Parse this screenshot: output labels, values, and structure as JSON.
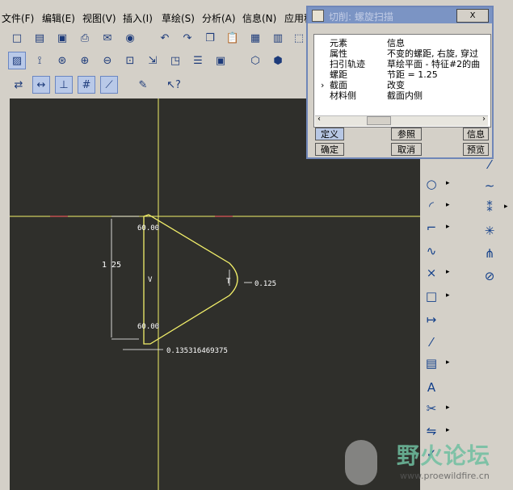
{
  "menu": [
    "文件(F)",
    "编辑(E)",
    "视图(V)",
    "插入(I)",
    "草绘(S)",
    "分析(A)",
    "信息(N)",
    "应用程"
  ],
  "dialog": {
    "title": "切削: 螺旋扫描",
    "close_label": "X",
    "columns": [
      "元素",
      "信息"
    ],
    "rows": [
      {
        "element": "属性",
        "info": "不变的螺距, 右旋, 穿过"
      },
      {
        "element": "扫引轨迹",
        "info": "草绘平面 - 特征#2的曲"
      },
      {
        "element": "螺距",
        "info": "节距 = 1.25"
      },
      {
        "element": "截面",
        "info": "改变",
        "current": true
      },
      {
        "element": "材料侧",
        "info": "截面内侧"
      }
    ],
    "buttons": {
      "define": "定义",
      "reference": "参照",
      "info": "信息",
      "ok": "确定",
      "cancel": "取消",
      "preview": "预览"
    }
  },
  "sketch": {
    "dim_height": "1 25",
    "dim_angle_top": "60.00",
    "dim_angle_bottom": "60.00",
    "dim_radius": "0.125",
    "dim_offset": "0.135316469375",
    "label_v": "V",
    "label_t": "T"
  },
  "watermark": {
    "name": "野火论坛",
    "url": "www.proewildfire.cn"
  },
  "colors": {
    "canvas": "#2f2f2b",
    "sketch": "#f3f06a",
    "dim": "#ffffff"
  }
}
